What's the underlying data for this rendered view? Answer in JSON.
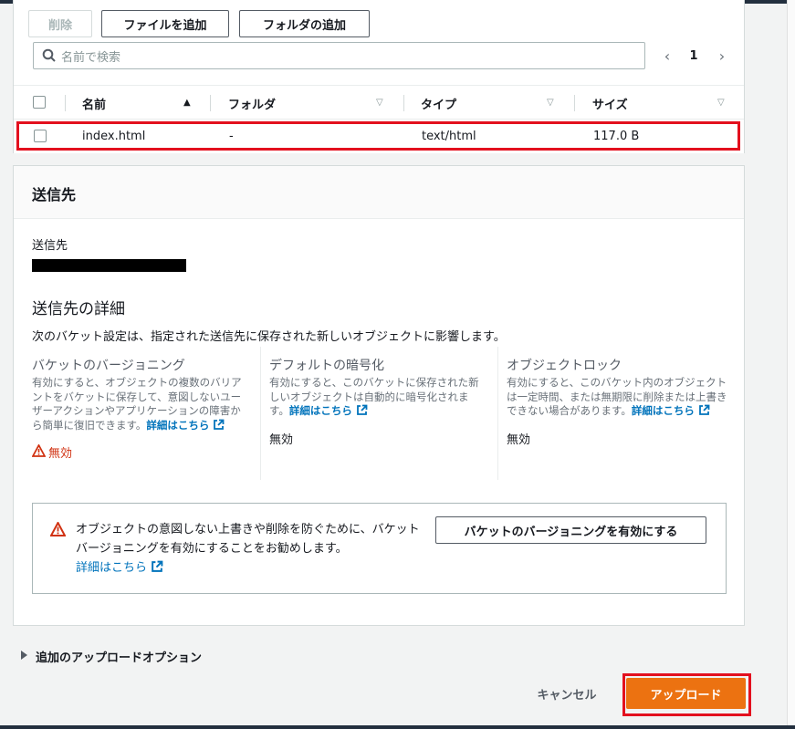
{
  "files": {
    "toolbar": {
      "delete_label": "削除",
      "add_files_label": "ファイルを追加",
      "add_folder_label": "フォルダの追加"
    },
    "search": {
      "placeholder": "名前で検索"
    },
    "pagination": {
      "page": "1",
      "prev": "‹",
      "next": "›"
    },
    "columns": [
      {
        "label": "名前",
        "sort": "▲"
      },
      {
        "label": "フォルダ",
        "sort": "▽"
      },
      {
        "label": "タイプ",
        "sort": "▽"
      },
      {
        "label": "サイズ",
        "sort": "▽"
      }
    ],
    "rows": [
      {
        "name": "index.html",
        "folder": "-",
        "type": "text/html",
        "size": "117.0 B"
      }
    ]
  },
  "destination": {
    "title": "送信先",
    "label": "送信先",
    "details_heading": "送信先の詳細",
    "details_desc": "次のバケット設定は、指定された送信先に保存された新しいオブジェクトに影響します。",
    "columns": [
      {
        "title": "バケットのバージョニング",
        "desc": "有効にすると、オブジェクトの複数のバリアントをバケットに保存して、意図しないユーザーアクションやアプリケーションの障害から簡単に復旧できます。",
        "link": "詳細はこちら",
        "value": "無効"
      },
      {
        "title": "デフォルトの暗号化",
        "desc": "有効にすると、このバケットに保存された新しいオブジェクトは自動的に暗号化されます。",
        "link": "詳細はこちら",
        "value": "無効"
      },
      {
        "title": "オブジェクトロック",
        "desc": "有効にすると、このバケット内のオブジェクトは一定時間、または無期限に削除または上書きできない場合があります。",
        "link": "詳細はこちら",
        "value": "無効"
      }
    ],
    "alert": {
      "text": "オブジェクトの意図しない上書きや削除を防ぐために、バケットバージョニングを有効にすることをお勧めします。",
      "link": "詳細はこちら",
      "button": "バケットのバージョニングを有効にする"
    }
  },
  "footer": {
    "more_options": "追加のアップロードオプション",
    "cancel": "キャンセル",
    "upload": "アップロード"
  },
  "colors": {
    "accent": "#ec7211",
    "highlight": "#e3101e",
    "link": "#0073bb",
    "warning": "#d13212"
  }
}
